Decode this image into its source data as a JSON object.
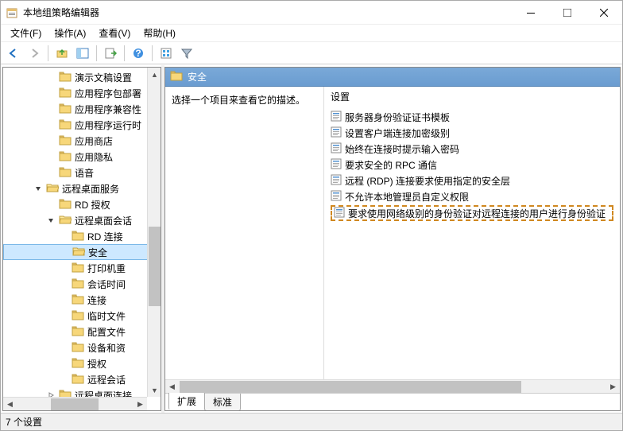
{
  "window": {
    "title": "本地组策略编辑器"
  },
  "menubar": {
    "items": [
      {
        "label": "文件(F)"
      },
      {
        "label": "操作(A)"
      },
      {
        "label": "查看(V)"
      },
      {
        "label": "帮助(H)"
      }
    ]
  },
  "toolbar": {
    "back": "nav-back",
    "forward": "nav-forward",
    "up": "nav-up",
    "show_hide": "show-hide-tree",
    "export": "export-list",
    "help": "help",
    "mmc": "mmc-action",
    "filter": "filter"
  },
  "tree": {
    "items": [
      {
        "indent": 4,
        "expander": "",
        "label": "演示文稿设置"
      },
      {
        "indent": 4,
        "expander": "",
        "label": "应用程序包部署"
      },
      {
        "indent": 4,
        "expander": "",
        "label": "应用程序兼容性"
      },
      {
        "indent": 4,
        "expander": "",
        "label": "应用程序运行时"
      },
      {
        "indent": 4,
        "expander": "",
        "label": "应用商店"
      },
      {
        "indent": 4,
        "expander": "",
        "label": "应用隐私"
      },
      {
        "indent": 4,
        "expander": "",
        "label": "语音"
      },
      {
        "indent": 3,
        "expander": "v",
        "label": "远程桌面服务"
      },
      {
        "indent": 4,
        "expander": "",
        "label": "RD 授权"
      },
      {
        "indent": 4,
        "expander": "v",
        "label": "远程桌面会话"
      },
      {
        "indent": 5,
        "expander": "",
        "label": "RD 连接"
      },
      {
        "indent": 5,
        "expander": "",
        "label": "安全",
        "selected": true
      },
      {
        "indent": 5,
        "expander": "",
        "label": "打印机重"
      },
      {
        "indent": 5,
        "expander": "",
        "label": "会话时间"
      },
      {
        "indent": 5,
        "expander": "",
        "label": "连接"
      },
      {
        "indent": 5,
        "expander": "",
        "label": "临时文件"
      },
      {
        "indent": 5,
        "expander": "",
        "label": "配置文件"
      },
      {
        "indent": 5,
        "expander": "",
        "label": "设备和资"
      },
      {
        "indent": 5,
        "expander": "",
        "label": "授权"
      },
      {
        "indent": 5,
        "expander": "",
        "label": "远程会话"
      },
      {
        "indent": 4,
        "expander": ">",
        "label": "远程桌面连接"
      }
    ]
  },
  "right": {
    "header_label": "安全",
    "description_prompt": "选择一个项目来查看它的描述。",
    "column_header": "设置",
    "settings": [
      {
        "label": "服务器身份验证证书模板",
        "highlight": false
      },
      {
        "label": "设置客户端连接加密级别",
        "highlight": false
      },
      {
        "label": "始终在连接时提示输入密码",
        "highlight": false
      },
      {
        "label": "要求安全的 RPC 通信",
        "highlight": false
      },
      {
        "label": "远程 (RDP) 连接要求使用指定的安全层",
        "highlight": false
      },
      {
        "label": "不允许本地管理员自定义权限",
        "highlight": false
      },
      {
        "label": "要求使用网络级别的身份验证对远程连接的用户进行身份验证",
        "highlight": true
      }
    ],
    "tabs": {
      "extended": "扩展",
      "standard": "标准"
    }
  },
  "statusbar": {
    "text": "7 个设置"
  }
}
